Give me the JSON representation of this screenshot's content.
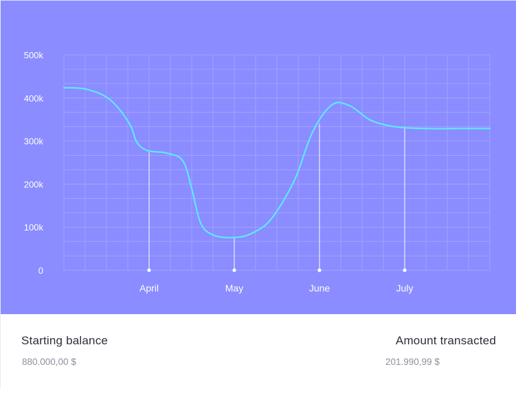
{
  "chart_data": {
    "type": "line",
    "y_ticks": [
      "500k",
      "400k",
      "300k",
      "200k",
      "100k",
      "0"
    ],
    "x_ticks": [
      "April",
      "May",
      "June",
      "July"
    ],
    "ylim": [
      0,
      500000
    ],
    "grid": true,
    "series": [
      {
        "color": "#5fe8ff",
        "points": [
          {
            "x": 0.0,
            "y": 424000
          },
          {
            "x": 0.65,
            "y": 420000
          },
          {
            "x": 1.3,
            "y": 396000
          },
          {
            "x": 1.85,
            "y": 340000
          },
          {
            "x": 2.05,
            "y": 298000
          },
          {
            "x": 2.35,
            "y": 278000
          },
          {
            "x": 2.9,
            "y": 272000
          },
          {
            "x": 3.35,
            "y": 254000
          },
          {
            "x": 3.6,
            "y": 190000
          },
          {
            "x": 3.85,
            "y": 110000
          },
          {
            "x": 4.2,
            "y": 82000
          },
          {
            "x": 4.8,
            "y": 76000
          },
          {
            "x": 5.3,
            "y": 86000
          },
          {
            "x": 5.85,
            "y": 120000
          },
          {
            "x": 6.5,
            "y": 210000
          },
          {
            "x": 7.0,
            "y": 320000
          },
          {
            "x": 7.55,
            "y": 384000
          },
          {
            "x": 8.05,
            "y": 382000
          },
          {
            "x": 8.65,
            "y": 348000
          },
          {
            "x": 9.35,
            "y": 333000
          },
          {
            "x": 10.2,
            "y": 329000
          },
          {
            "x": 11.2,
            "y": 329000
          },
          {
            "x": 12.0,
            "y": 329000
          }
        ]
      }
    ],
    "markers": [
      {
        "label": "April",
        "x": 2.4,
        "y": 274000
      },
      {
        "label": "May",
        "x": 4.8,
        "y": 76000
      },
      {
        "label": "June",
        "x": 7.2,
        "y": 340000
      },
      {
        "label": "July",
        "x": 9.6,
        "y": 331000
      }
    ],
    "x_domain": [
      0,
      12
    ]
  },
  "colors": {
    "background": "#8a8cff",
    "line": "#5fe8ff",
    "grid": "#a7aaff",
    "text": "#ffffff"
  },
  "stats": {
    "starting_label": "Starting balance",
    "starting_value": "880.000,00 $",
    "amount_label": "Amount transacted",
    "amount_value": "201.990,99 $"
  }
}
